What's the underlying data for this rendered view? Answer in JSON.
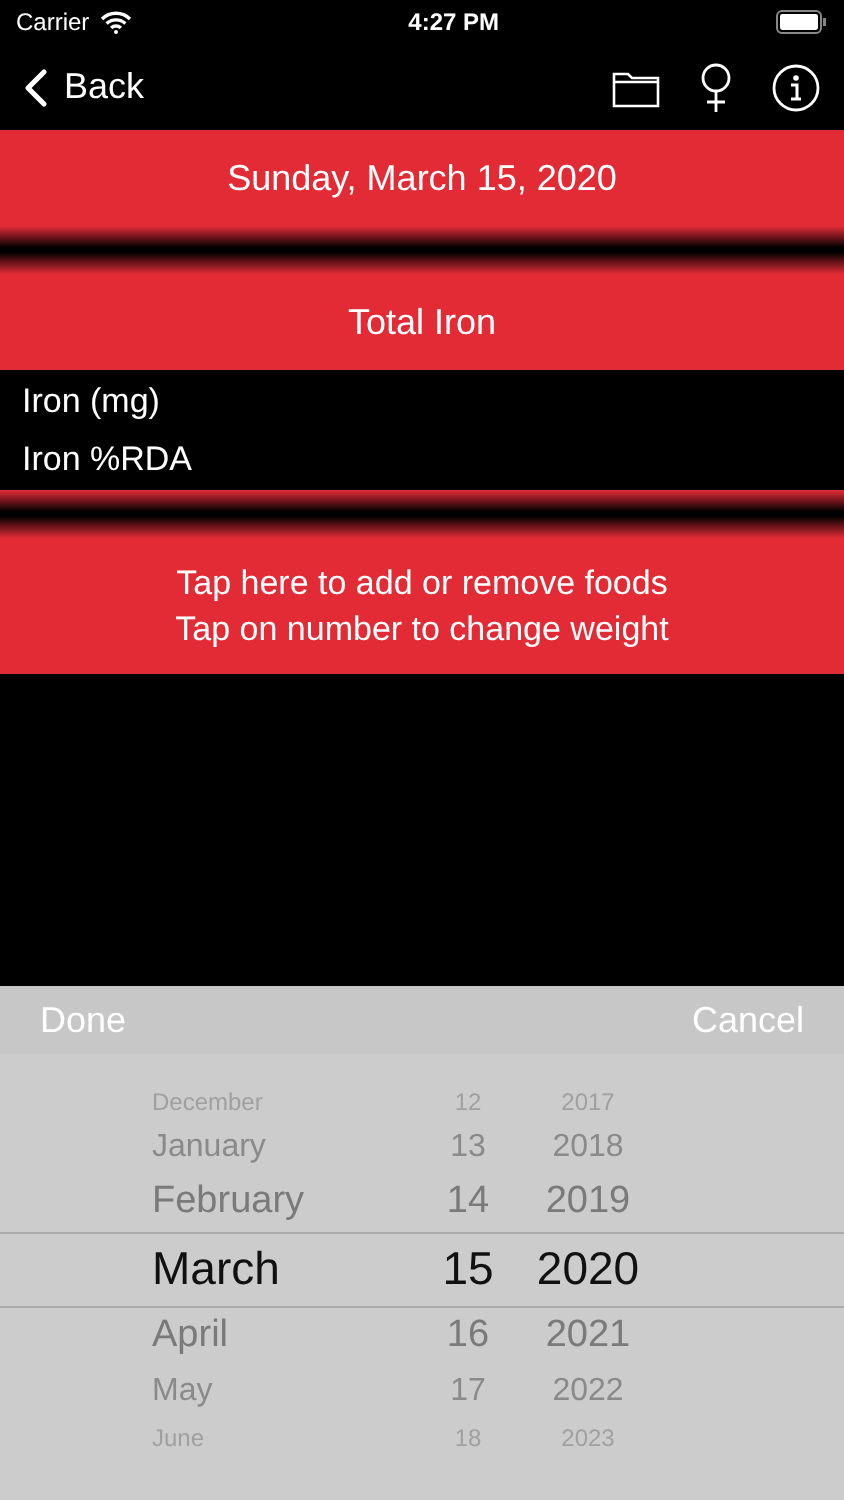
{
  "status_bar": {
    "carrier": "Carrier",
    "time": "4:27 PM"
  },
  "nav": {
    "back": "Back"
  },
  "date_header": "Sunday, March 15, 2020",
  "section_title": "Total Iron",
  "nutrients": [
    "Iron (mg)",
    "Iron %RDA"
  ],
  "food_prompt": [
    "Tap here to add or remove foods",
    "Tap on number to change weight"
  ],
  "picker_toolbar": {
    "done": "Done",
    "cancel": "Cancel"
  },
  "picker_rows": [
    {
      "month": "December",
      "day": "12",
      "year": "2017",
      "selected": false
    },
    {
      "month": "January",
      "day": "13",
      "year": "2018",
      "selected": false
    },
    {
      "month": "February",
      "day": "14",
      "year": "2019",
      "selected": false
    },
    {
      "month": "March",
      "day": "15",
      "year": "2020",
      "selected": true
    },
    {
      "month": "April",
      "day": "16",
      "year": "2021",
      "selected": false
    },
    {
      "month": "May",
      "day": "17",
      "year": "2022",
      "selected": false
    },
    {
      "month": "June",
      "day": "18",
      "year": "2023",
      "selected": false
    }
  ]
}
